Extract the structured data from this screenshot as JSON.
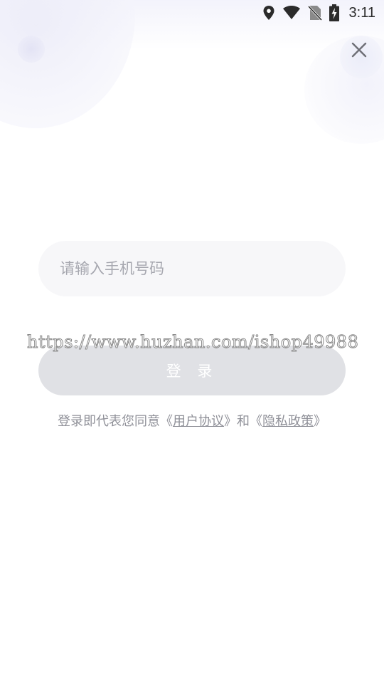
{
  "status_bar": {
    "time": "3:11",
    "icons": [
      "location-icon",
      "wifi-icon",
      "no-sim-icon",
      "battery-charging-icon"
    ]
  },
  "header": {
    "close_icon": "close-icon"
  },
  "form": {
    "phone_placeholder": "请输入手机号码",
    "phone_value": "",
    "login_label": "登 录"
  },
  "agreement": {
    "prefix": "登录即代表您同意",
    "open_quote_1": "《",
    "user_agreement": "用户协议",
    "close_quote_1": "》",
    "connector": "和",
    "open_quote_2": "《",
    "privacy_policy": "隐私政策",
    "close_quote_2": "》"
  },
  "watermark": "https://www.huzhan.com/ishop49988",
  "colors": {
    "input_bg": "#f7f7f9",
    "button_disabled_bg": "#e0e1e5",
    "text_muted": "#8f9098",
    "placeholder": "#a7a8b0"
  }
}
